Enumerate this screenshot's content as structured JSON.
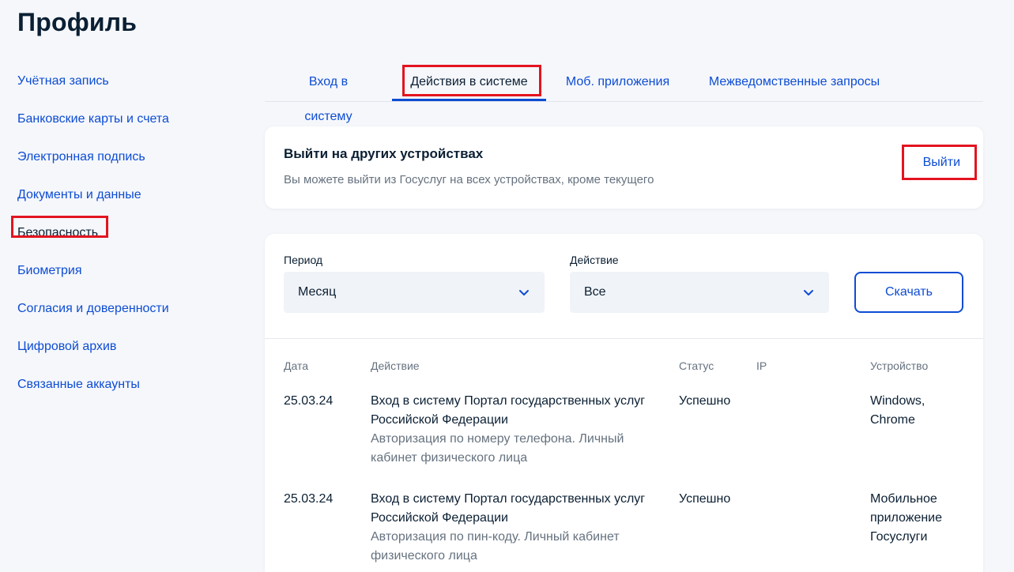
{
  "page": {
    "title": "Профиль"
  },
  "sidebar": {
    "items": [
      {
        "label": "Учётная запись"
      },
      {
        "label": "Банковские карты и счета"
      },
      {
        "label": "Электронная подпись"
      },
      {
        "label": "Документы и данные"
      },
      {
        "label": "Безопасность"
      },
      {
        "label": "Биометрия"
      },
      {
        "label": "Согласия и доверенности"
      },
      {
        "label": "Цифровой архив"
      },
      {
        "label": "Связанные аккаунты"
      }
    ]
  },
  "tabs": [
    {
      "label": "Вход в систему"
    },
    {
      "label": "Действия в системе"
    },
    {
      "label": "Моб. приложения"
    },
    {
      "label": "Межведомственные запросы"
    }
  ],
  "logout_card": {
    "title": "Выйти на других устройствах",
    "description": "Вы можете выйти из Госуслуг на всех устройствах, кроме текущего",
    "button": "Выйти"
  },
  "filters": {
    "period": {
      "label": "Период",
      "value": "Месяц"
    },
    "action": {
      "label": "Действие",
      "value": "Все"
    },
    "download": "Скачать"
  },
  "table": {
    "headers": {
      "date": "Дата",
      "action": "Действие",
      "status": "Статус",
      "ip": "IP",
      "device": "Устройство"
    },
    "rows": [
      {
        "date": "25.03.24",
        "action": "Вход в систему Портал государственных услуг Российской Федерации",
        "detail": "Авторизация по номеру телефона. Личный кабинет физического лица",
        "status": "Успешно",
        "ip": "",
        "device": "Windows, Chrome"
      },
      {
        "date": "25.03.24",
        "action": "Вход в систему Портал государственных услуг Российской Федерации",
        "detail": "Авторизация по пин-коду. Личный кабинет физического лица",
        "status": "Успешно",
        "ip": "",
        "device": "Мобильное приложение Госуслуги"
      }
    ]
  },
  "colors": {
    "accent": "#0d4cd3",
    "text": "#0b1f33",
    "muted": "#66727f",
    "highlight": "#e3141f",
    "background": "#f5f7fb"
  }
}
